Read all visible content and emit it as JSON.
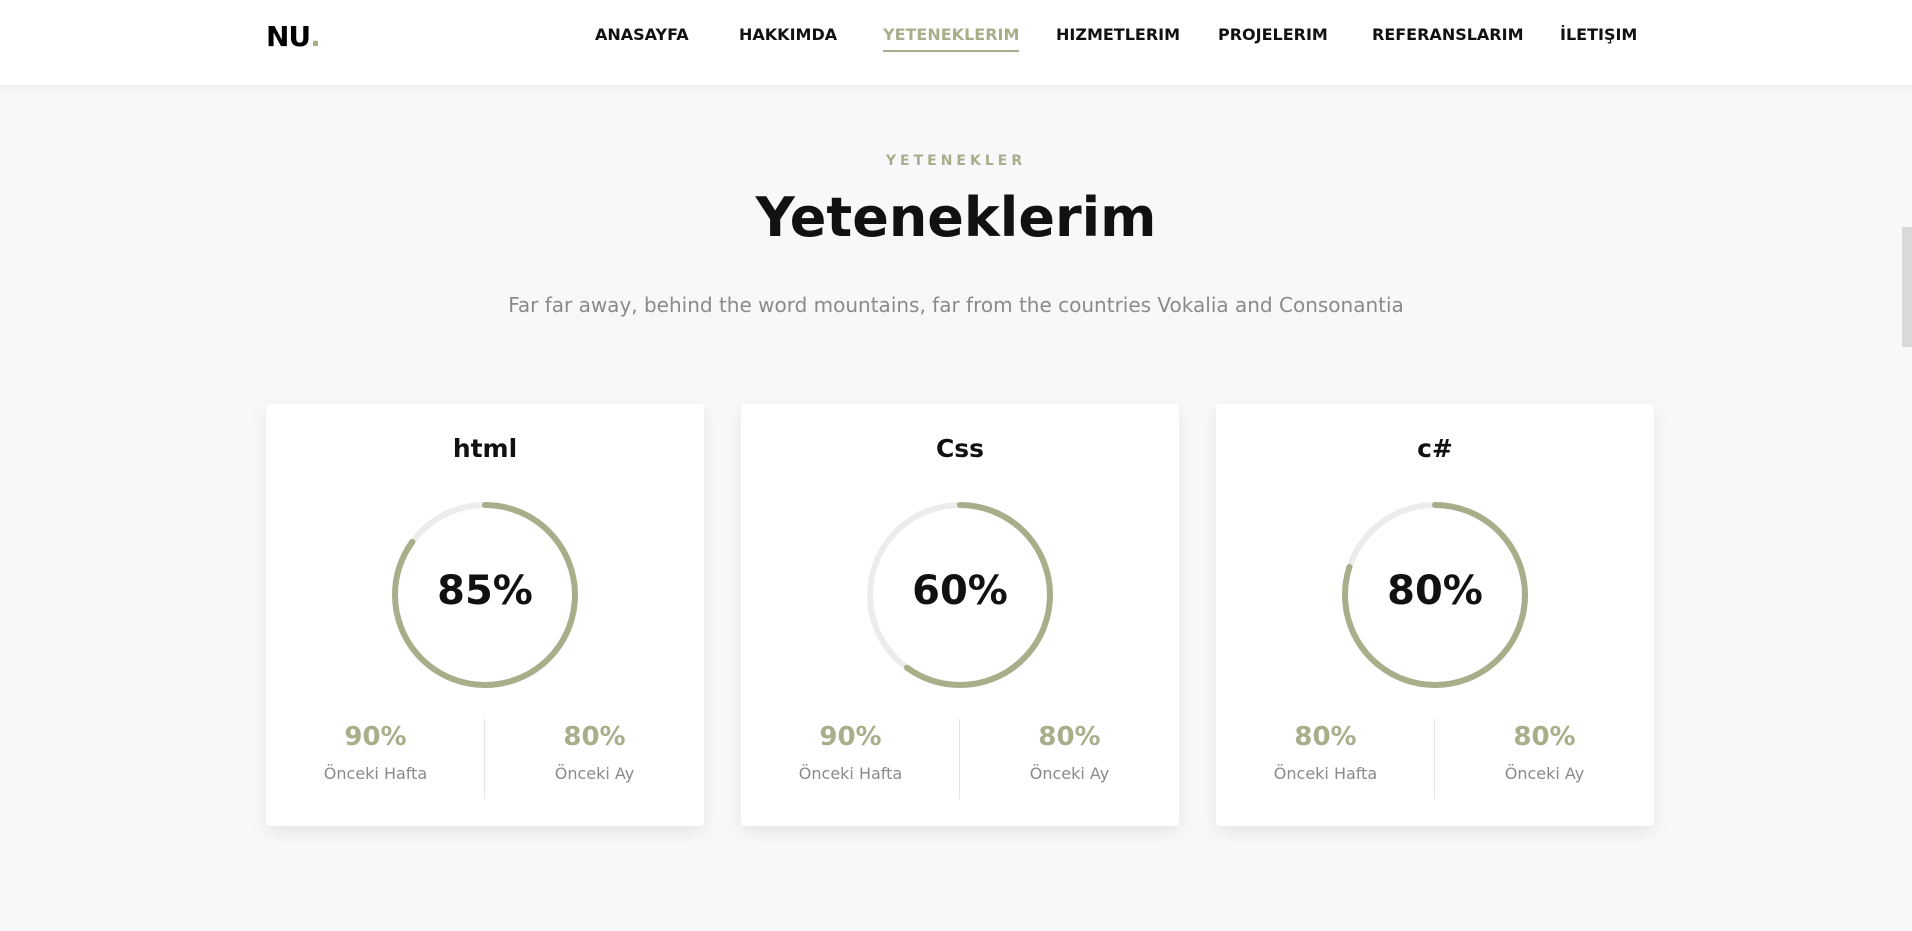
{
  "colors": {
    "accent": "#a8ae8a",
    "track": "#ececec",
    "text": "#111111",
    "muted": "#8a8a8a"
  },
  "logo": {
    "text": "NU",
    "dot": "."
  },
  "nav": {
    "items": [
      {
        "label": "ANASAYFA"
      },
      {
        "label": "HAKKIMDA"
      },
      {
        "label": "YETENEKLERIM",
        "active": true
      },
      {
        "label": "HIZMETLERIM"
      },
      {
        "label": "PROJELERIM"
      },
      {
        "label": "REFERANSLARIM"
      },
      {
        "label": "İLETIŞIM"
      }
    ]
  },
  "section": {
    "subheading": "YETENEKLER",
    "title": "Yeteneklerim",
    "description": "Far far away, behind the word mountains, far from the countries Vokalia and Consonantia"
  },
  "skills": [
    {
      "name": "html",
      "percent": 85,
      "percent_label": "85%",
      "prev_week": "90%",
      "prev_week_label": "Önceki Hafta",
      "prev_month": "80%",
      "prev_month_label": "Önceki Ay"
    },
    {
      "name": "Css",
      "percent": 60,
      "percent_label": "60%",
      "prev_week": "90%",
      "prev_week_label": "Önceki Hafta",
      "prev_month": "80%",
      "prev_month_label": "Önceki Ay"
    },
    {
      "name": "c#",
      "percent": 80,
      "percent_label": "80%",
      "prev_week": "80%",
      "prev_week_label": "Önceki Hafta",
      "prev_month": "80%",
      "prev_month_label": "Önceki Ay"
    }
  ]
}
